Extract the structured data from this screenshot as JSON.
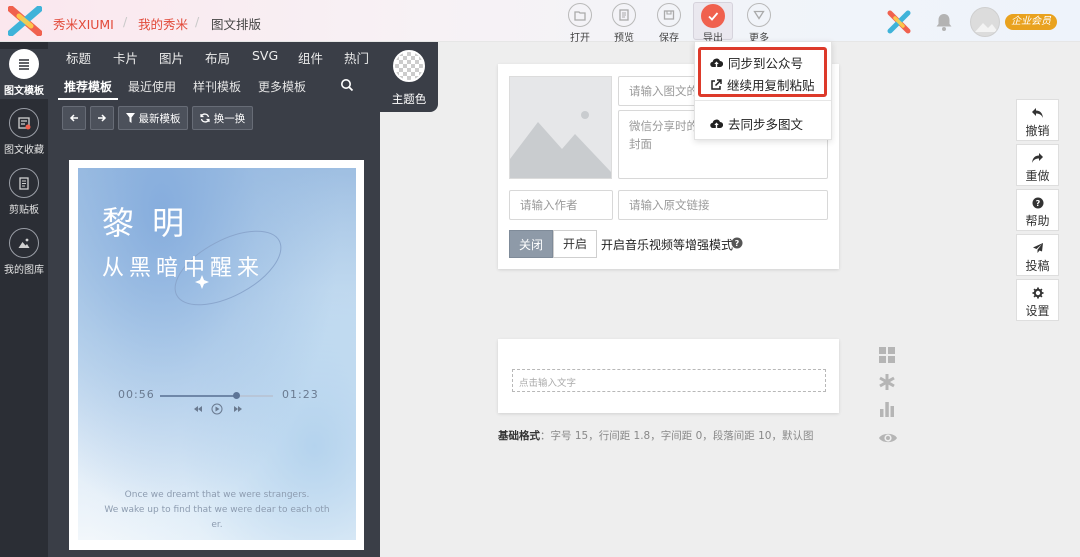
{
  "header": {
    "brand": "秀米XIUMI",
    "breadcrumb": [
      "我的秀米",
      "图文排版"
    ],
    "separator": "/",
    "toolbar": [
      {
        "label": "打开",
        "icon": "folder-open-icon"
      },
      {
        "label": "预览",
        "icon": "preview-icon"
      },
      {
        "label": "保存",
        "icon": "save-icon"
      },
      {
        "label": "导出",
        "icon": "checkmark-icon",
        "active": true
      },
      {
        "label": "更多",
        "icon": "triangle-down-icon"
      }
    ],
    "member_badge": "企业会员"
  },
  "rail": [
    {
      "label": "图文模板",
      "icon": "list-icon",
      "active": true
    },
    {
      "label": "图文收藏",
      "icon": "favorites-icon"
    },
    {
      "label": "剪贴板",
      "icon": "clipboard-icon"
    },
    {
      "label": "我的图库",
      "icon": "image-library-icon"
    }
  ],
  "panel": {
    "top_tabs": [
      "标题",
      "卡片",
      "图片",
      "布局",
      "SVG",
      "组件",
      "热门"
    ],
    "sub_tabs": [
      "推荐模板",
      "最近使用",
      "样刊模板",
      "更多模板"
    ],
    "active_sub_tab": "推荐模板",
    "filter_button": "最新模板",
    "shuffle_button": "换一换",
    "theme_label": "主题色"
  },
  "template_preview": {
    "title": "黎 明",
    "subtitle": "从黑暗中醒来",
    "time_start": "00:56",
    "time_end": "01:23",
    "progress": 0.68,
    "quote_lines": [
      "Once we dreamt that we were strangers.",
      "We wake up to find that we were dear to each oth",
      "er."
    ]
  },
  "doc_card": {
    "title_placeholder": "请输入图文的",
    "summary_placeholder": "微信分享时的\n封面",
    "author_placeholder": "请输入作者",
    "link_placeholder": "请输入原文链接",
    "toggle_off": "关闭",
    "toggle_on": "开启",
    "enhance_label": "开启音乐视频等增强模式",
    "text_placeholder": "点击输入文字"
  },
  "format_info": {
    "label": "基础格式",
    "value": "：字号 15，行间距 1.8，字间距 0，段落间距 10，默认图"
  },
  "export_menu": [
    {
      "label": "同步到公众号",
      "icon": "cloud-upload-icon",
      "highlighted": true
    },
    {
      "label": "继续用复制粘贴",
      "icon": "external-link-icon",
      "highlighted": true
    },
    {
      "label": "去同步多图文",
      "icon": "cloud-upload-icon",
      "highlighted": false
    }
  ],
  "right_actions": [
    {
      "label": "撤销",
      "icon": "undo-icon"
    },
    {
      "label": "重做",
      "icon": "redo-icon"
    },
    {
      "label": "帮助",
      "icon": "help-icon"
    },
    {
      "label": "投稿",
      "icon": "send-icon"
    },
    {
      "label": "设置",
      "icon": "gear-icon"
    }
  ],
  "colors": {
    "brand_red": "#f0614e",
    "highlight_red": "#dd3a2a",
    "panel_dark": "#3a3e47",
    "rail_dark": "#2b2e35",
    "member_gold": "#e9a21f"
  }
}
